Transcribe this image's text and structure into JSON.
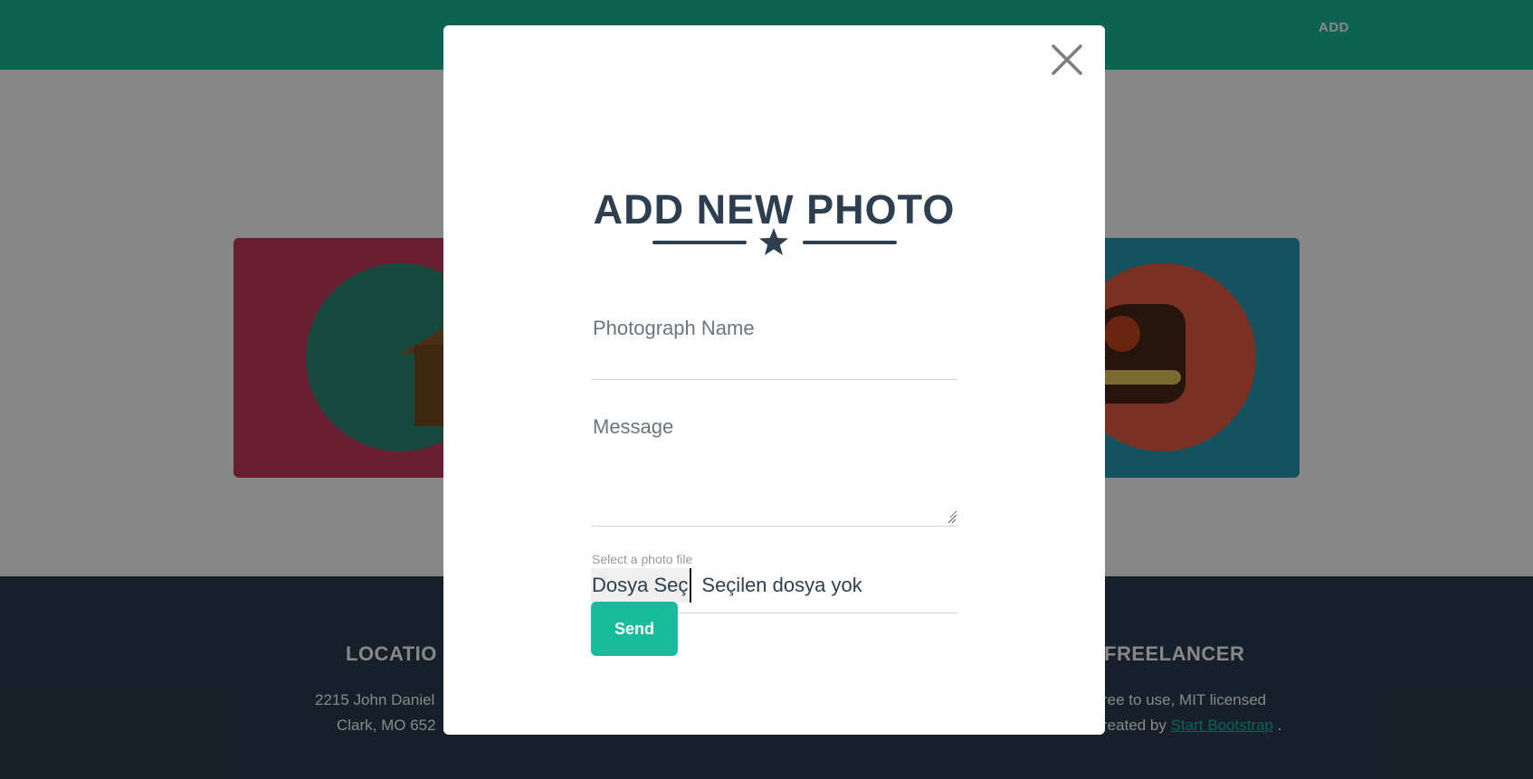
{
  "navbar": {
    "add_label": "ADD"
  },
  "footer": {
    "location_heading": "LOCATIO",
    "location_line1": "2215 John Daniel",
    "location_line2": "Clark, MO 652",
    "about_heading": "FREELANCER",
    "about_line1": "ree to use, MIT licensed",
    "about_line2_prefix": "reated by",
    "about_link": "Start Bootstrap",
    "about_line2_suffix": "."
  },
  "modal": {
    "title": "ADD NEW PHOTO",
    "name_placeholder": "Photograph Name",
    "message_placeholder": "Message",
    "file_label": "Select a photo file",
    "file_button": "Dosya Seç",
    "file_status": "Seçilen dosya yok",
    "send_label": "Send"
  },
  "colors": {
    "primary": "#18bc9c",
    "dark": "#2c3e50",
    "overlay": "rgba(0,0,0,0.47)"
  },
  "icons": {
    "close": "close-icon",
    "star": "star-icon",
    "resize": "resize-grip-icon"
  }
}
